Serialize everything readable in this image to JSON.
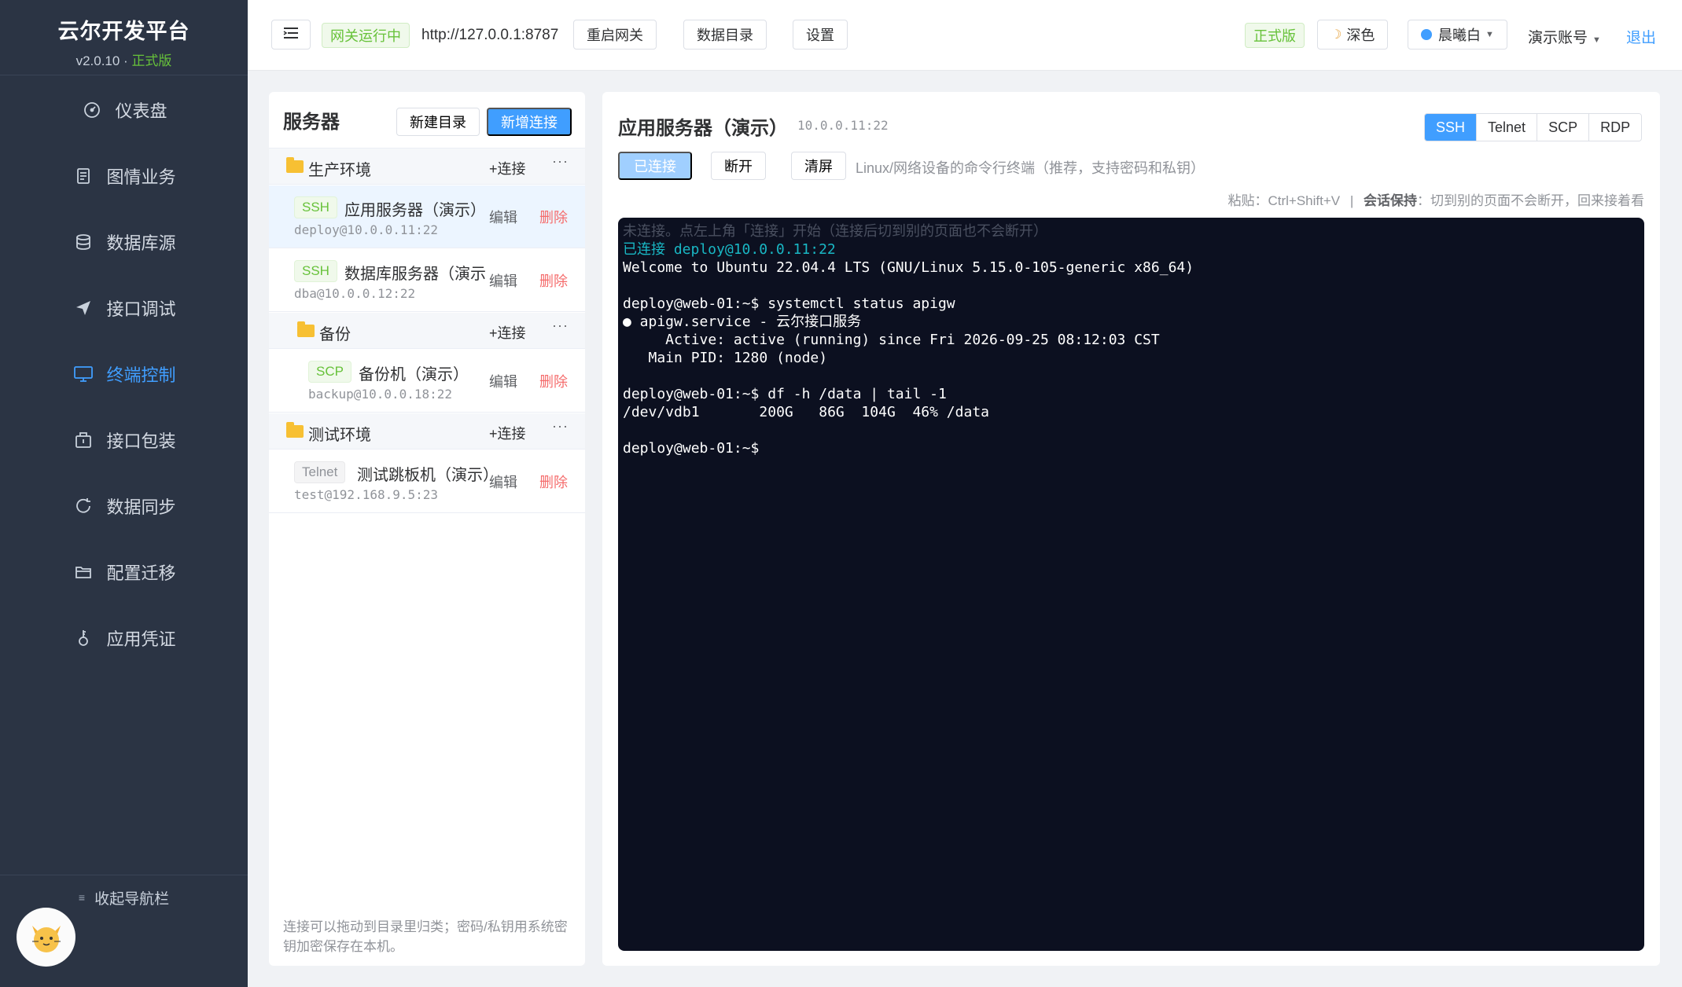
{
  "sidebar": {
    "brand_title": "云尔开发平台",
    "version": "v2.0.10 · ",
    "edition": "正式版",
    "items": [
      {
        "label": "仪表盘",
        "icon": "dashboard-icon"
      },
      {
        "label": "图情业务",
        "icon": "document-icon"
      },
      {
        "label": "数据库源",
        "icon": "database-icon"
      },
      {
        "label": "接口调试",
        "icon": "send-icon"
      },
      {
        "label": "终端控制",
        "icon": "monitor-icon"
      },
      {
        "label": "接口包装",
        "icon": "package-icon"
      },
      {
        "label": "数据同步",
        "icon": "sync-icon"
      },
      {
        "label": "配置迁移",
        "icon": "folder-open-icon"
      },
      {
        "label": "应用凭证",
        "icon": "key-icon"
      }
    ],
    "active_index": 4,
    "collapse_label": "收起导航栏"
  },
  "topbar": {
    "gateway_status": "网关运行中",
    "gateway_url": "http://127.0.0.1:8787",
    "restart_label": "重启网关",
    "datadir_label": "数据目录",
    "settings_label": "设置",
    "edition_tag": "正式版",
    "dark_label": "深色",
    "theme_label": "晨曦白",
    "account_label": "演示账号",
    "logout_label": "退出"
  },
  "servers": {
    "title": "服务器",
    "new_folder_label": "新建目录",
    "new_conn_label": "新增连接",
    "connect_label": "+连接",
    "edit_label": "编辑",
    "delete_label": "删除",
    "more_label": "···",
    "folders": [
      {
        "name": "生产环境"
      },
      {
        "name": "备份"
      },
      {
        "name": "测试环境"
      }
    ],
    "connections": [
      {
        "protocol": "SSH",
        "name": "应用服务器（演示）",
        "addr": "deploy@10.0.0.11:22"
      },
      {
        "protocol": "SSH",
        "name": "数据库服务器（演示）",
        "addr": "dba@10.0.0.12:22"
      },
      {
        "protocol": "SCP",
        "name": "备份机（演示）",
        "addr": "backup@10.0.0.18:22"
      },
      {
        "protocol": "Telnet",
        "name": "测试跳板机（演示）",
        "addr": "test@192.168.9.5:23"
      }
    ],
    "footer": "连接可以拖动到目录里归类；密码/私钥用系统密钥加密保存在本机。"
  },
  "session": {
    "title": "应用服务器（演示）",
    "addr": "10.0.0.11:22",
    "protocols": [
      "SSH",
      "Telnet",
      "SCP",
      "RDP"
    ],
    "active_protocol": "SSH",
    "connected_label": "已连接",
    "disconnect_label": "断开",
    "clear_label": "清屏",
    "description": "Linux/网络设备的命令行终端（推荐，支持密码和私钥）",
    "hint_paste": "粘贴：Ctrl+Shift+V",
    "hint_sep": "|",
    "hint_keep_label": "会话保持",
    "hint_keep_text": "：切到别的页面不会断开，回来接着看"
  },
  "terminal": {
    "lines": [
      {
        "text": "未连接。点左上角「连接」开始（连接后切到别的页面也不会断开）",
        "style": "muted"
      },
      {
        "text": "已连接 deploy@10.0.0.11:22",
        "style": "cyan"
      },
      {
        "text": "Welcome to Ubuntu 22.04.4 LTS (GNU/Linux 5.15.0-105-generic x86_64)",
        "style": "normal"
      },
      {
        "text": "",
        "style": "normal"
      },
      {
        "text": "deploy@web-01:~$ systemctl status apigw",
        "style": "normal"
      },
      {
        "text": "● apigw.service - 云尔接口服务",
        "style": "normal"
      },
      {
        "text": "     Active: active (running) since Fri 2026-09-25 08:12:03 CST",
        "style": "normal"
      },
      {
        "text": "   Main PID: 1280 (node)",
        "style": "normal"
      },
      {
        "text": "",
        "style": "normal"
      },
      {
        "text": "deploy@web-01:~$ df -h /data | tail -1",
        "style": "normal"
      },
      {
        "text": "/dev/vdb1       200G   86G  104G  46% /data",
        "style": "normal"
      },
      {
        "text": "",
        "style": "normal"
      },
      {
        "text": "deploy@web-01:~$ ",
        "style": "normal"
      }
    ]
  },
  "colors": {
    "accent": "#409eff",
    "sidebar_bg": "#2b3444",
    "success": "#67c23a",
    "danger": "#f56c6c",
    "terminal_bg": "#0c1020"
  }
}
